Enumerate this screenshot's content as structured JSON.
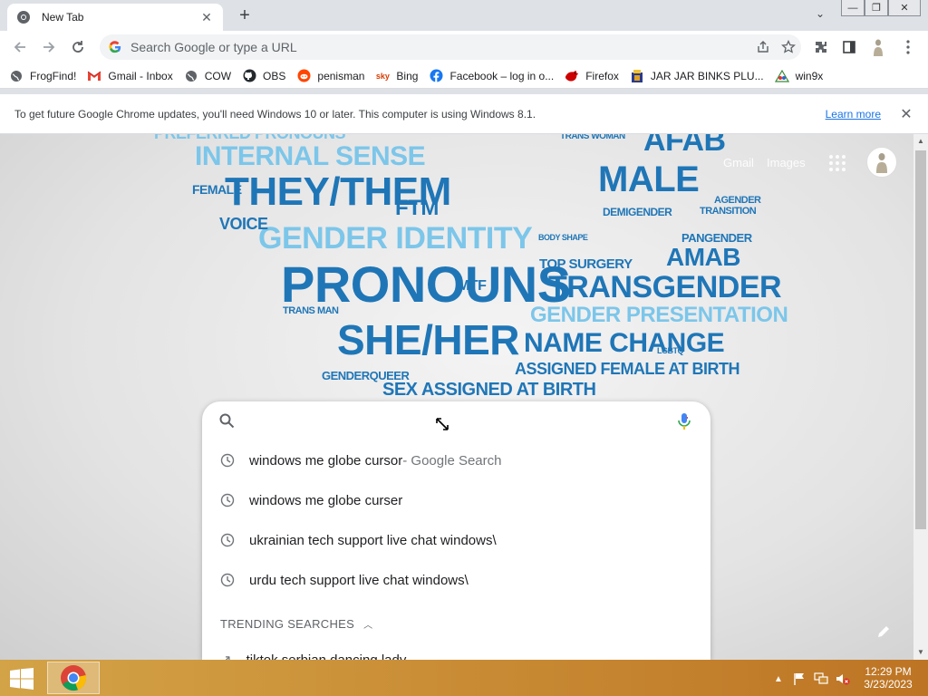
{
  "browser": {
    "tab_title": "New Tab",
    "omnibox_placeholder": "Search Google or type a URL"
  },
  "bookmarks": [
    {
      "label": "FrogFind!",
      "icon": "globe-icon"
    },
    {
      "label": "Gmail - Inbox",
      "icon": "gmail-icon"
    },
    {
      "label": "COW",
      "icon": "globe-icon"
    },
    {
      "label": "OBS",
      "icon": "github-icon"
    },
    {
      "label": "penisman",
      "icon": "reddit-icon"
    },
    {
      "label": "Bing",
      "icon": "bing-icon"
    },
    {
      "label": "Facebook – log in o...",
      "icon": "facebook-icon"
    },
    {
      "label": "Firefox",
      "icon": "firefox-icon"
    },
    {
      "label": "JAR JAR BINKS PLU...",
      "icon": "bookmark-icon"
    },
    {
      "label": "win9x",
      "icon": "win9x-icon"
    }
  ],
  "infobar": {
    "message": "To get future Google Chrome updates, you'll need Windows 10 or later. This computer is using Windows 8.1.",
    "link": "Learn more"
  },
  "ntp": {
    "gmail_link": "Gmail",
    "images_link": "Images",
    "suggestions": [
      {
        "text": "windows me globe cursor",
        "suffix": " - Google Search"
      },
      {
        "text": "windows me globe curser",
        "suffix": ""
      },
      {
        "text": "ukrainian tech support live chat windows\\",
        "suffix": ""
      },
      {
        "text": "urdu tech support live chat windows\\",
        "suffix": ""
      }
    ],
    "trending_header": "TRENDING SEARCHES",
    "trending_first": "tiktok serbian dancing lady"
  },
  "wordcloud": [
    {
      "t": "PREFERRED PRONOUNS",
      "c": "l"
    },
    {
      "t": "INTERNAL SENSE",
      "c": "l"
    },
    {
      "t": "THEY/THEM",
      "c": "d"
    },
    {
      "t": "GENDER IDENTITY",
      "c": "l"
    },
    {
      "t": "PRONOUNS",
      "c": "d"
    },
    {
      "t": "SHE/HER",
      "c": "d"
    },
    {
      "t": "SEX ASSIGNED AT BIRTH",
      "c": "d"
    },
    {
      "t": "FTM",
      "c": "d"
    },
    {
      "t": "VOICE",
      "c": "d"
    },
    {
      "t": "FEMALE",
      "c": "d"
    },
    {
      "t": "MALE",
      "c": "d"
    },
    {
      "t": "AFAB",
      "c": "d"
    },
    {
      "t": "AMAB",
      "c": "d"
    },
    {
      "t": "TRANSGENDER",
      "c": "d"
    },
    {
      "t": "GENDER PRESENTATION",
      "c": "l"
    },
    {
      "t": "NAME CHANGE",
      "c": "d"
    },
    {
      "t": "ASSIGNED FEMALE AT BIRTH",
      "c": "d"
    },
    {
      "t": "TOP SURGERY",
      "c": "d"
    },
    {
      "t": "DEMIGENDER",
      "c": "d"
    },
    {
      "t": "PANGENDER",
      "c": "d"
    },
    {
      "t": "AGENDER",
      "c": "d"
    },
    {
      "t": "TRANSITION",
      "c": "d"
    },
    {
      "t": "TRANS WOMAN",
      "c": "d"
    },
    {
      "t": "GENDERQUEER",
      "c": "d"
    },
    {
      "t": "TRANS MAN",
      "c": "d"
    },
    {
      "t": "MTF",
      "c": "d"
    },
    {
      "t": "LGBTQ",
      "c": "d"
    },
    {
      "t": "BODY SHAPE",
      "c": "d"
    }
  ],
  "taskbar": {
    "time": "12:29 PM",
    "date": "3/23/2023"
  },
  "colors": {
    "accent": "#1a73e8",
    "wordcloud_light": "#3aa6dd",
    "wordcloud_dark": "#1f76b7",
    "taskbar": "#c98c35"
  }
}
